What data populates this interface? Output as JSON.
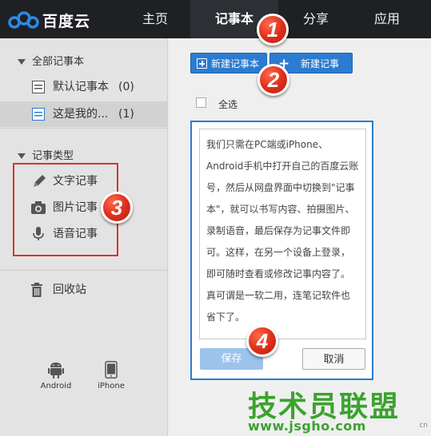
{
  "app": {
    "logo_text": "百度云"
  },
  "nav": {
    "home": "主页",
    "notes": "记事本",
    "share": "分享",
    "apps": "应用"
  },
  "sidebar": {
    "all_notebooks_header": "全部记事本",
    "notebooks": [
      {
        "label": "默认记事本",
        "count": "(0)",
        "icon": "notebook-icon"
      },
      {
        "label": "这是我的...",
        "count": "(1)",
        "icon": "notebook-icon"
      }
    ],
    "types_header": "记事类型",
    "types": [
      {
        "label": "文字记事",
        "icon": "pencil-icon"
      },
      {
        "label": "图片记事",
        "icon": "camera-icon"
      },
      {
        "label": "语音记事",
        "icon": "microphone-icon"
      }
    ],
    "trash": "回收站",
    "devices": [
      {
        "label": "Android",
        "icon": "android-icon"
      },
      {
        "label": "iPhone",
        "icon": "iphone-icon"
      }
    ]
  },
  "toolbar": {
    "new_notebook": "新建记事本",
    "new_note": "新建记事"
  },
  "list": {
    "select_all": "全选"
  },
  "editor": {
    "content": "我们只需在PC端或iPhone、Android手机中打开自己的百度云账号，然后从网盘界面中切换到\"记事本\"，就可以书写内容、拍摄图片、录制语音，最后保存为记事文件即可。这样，在另一个设备上登录，即可随时查看或修改记事内容了。真可谓是一软二用，连笔记软件也省下了。",
    "save": "保存",
    "cancel": "取消"
  },
  "badges": [
    "1",
    "2",
    "3",
    "4"
  ],
  "watermark": {
    "title": "技术员联盟",
    "url": "www.jsgho.com",
    "suffix": "cn"
  },
  "colors": {
    "topbar": "#1e2024",
    "accent_blue": "#2b7bd0",
    "badge_red": "#e0301c",
    "highlight_box": "#d9342b",
    "watermark_green": "#3aa32d"
  }
}
